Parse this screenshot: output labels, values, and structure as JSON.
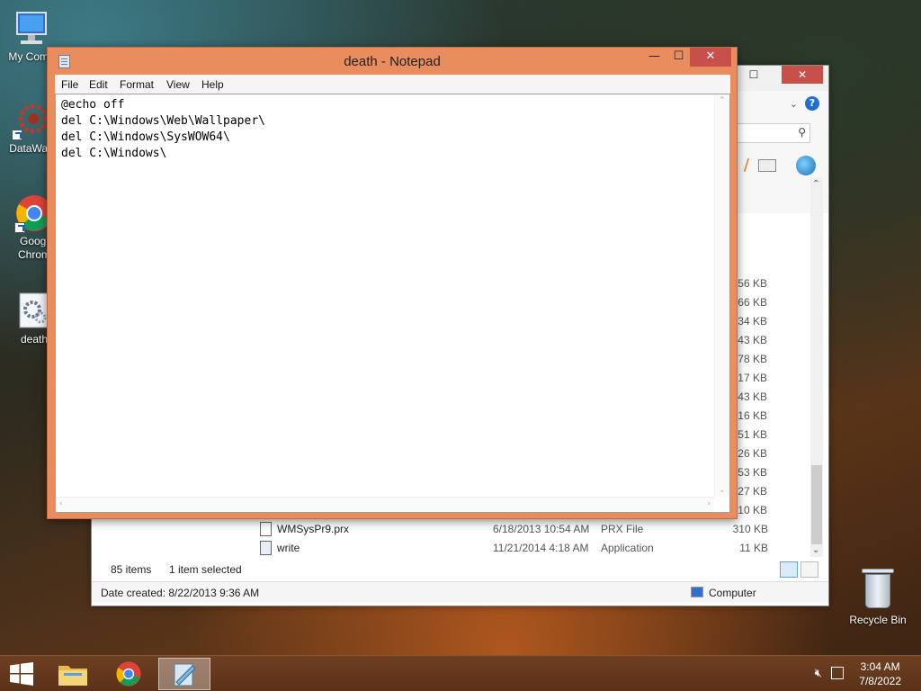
{
  "desktop": {
    "icons": [
      {
        "label": "My Comp",
        "icon": "computer-icon"
      },
      {
        "label": "DataWag",
        "icon": "gear-shortcut-icon"
      },
      {
        "label": "Googl\nChrom",
        "icon": "chrome-icon"
      },
      {
        "label": "death",
        "icon": "batch-file-icon"
      }
    ],
    "recycle_bin": {
      "label": "Recycle Bin",
      "icon": "recycle-bin-icon"
    }
  },
  "explorer": {
    "sizes": [
      "56 KB",
      "66 KB",
      "34 KB",
      "443 KB",
      "978 KB",
      "17 KB",
      "43 KB",
      "216 KB",
      "151 KB",
      "126 KB",
      "53 KB",
      "227 KB",
      "10 KB"
    ],
    "files": [
      {
        "name": "WMSysPr9.prx",
        "date": "6/18/2013 10:54 AM",
        "type": "PRX File",
        "size": "310 KB"
      },
      {
        "name": "write",
        "date": "11/21/2014 4:18 AM",
        "type": "Application",
        "size": "11 KB"
      }
    ],
    "status": {
      "items": "85 items",
      "selected": "1 item selected"
    },
    "details": {
      "date_created": "Date created: 8/22/2013 9:36 AM",
      "location": "Computer"
    },
    "caption": {
      "minimize": "—",
      "maximize": "☐",
      "close": "✕"
    }
  },
  "notepad": {
    "title": "death - Notepad",
    "menu": [
      "File",
      "Edit",
      "Format",
      "View",
      "Help"
    ],
    "content": "@echo off\ndel C:\\Windows\\Web\\Wallpaper\\\ndel C:\\Windows\\SysWOW64\\\ndel C:\\Windows\\",
    "caption": {
      "minimize": "—",
      "maximize": "☐",
      "close": "✕"
    }
  },
  "taskbar": {
    "time": "3:04 AM",
    "date": "7/8/2022"
  },
  "colors": {
    "notepad_frame": "#ea8d5e",
    "close_button": "#c7504a",
    "taskbar": "#5a3218"
  }
}
